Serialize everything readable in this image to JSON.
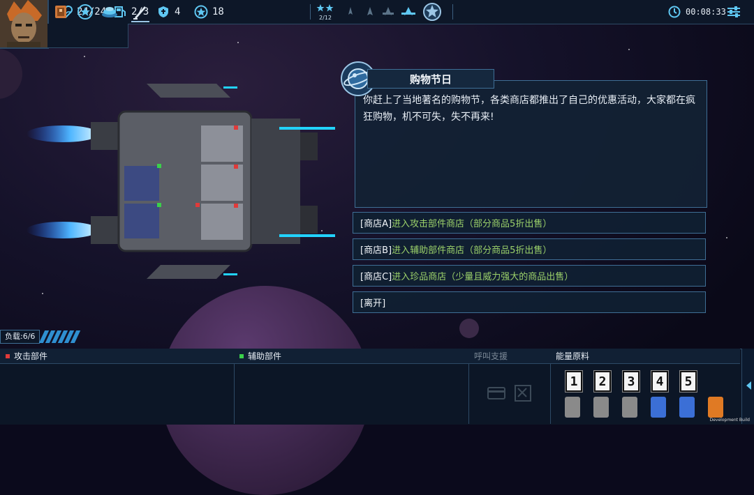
{
  "topbar": {
    "hull": "24/24",
    "fuel": "2/3",
    "shield": "4",
    "stars": "18",
    "sector_progress": "2/12",
    "timer": "00:08:33",
    "icons": [
      "heart-icon",
      "fuel-icon",
      "shield-icon",
      "star-coin-icon",
      "clock-icon",
      "settings-icon"
    ]
  },
  "event": {
    "title": "购物节日",
    "description": "你赶上了当地著名的购物节，各类商店都推出了自己的优惠活动，大家都在疯狂购物，机不可失，失不再来!",
    "options": [
      {
        "tag": "[商店A]",
        "text": "进入攻击部件商店（部分商品5折出售）"
      },
      {
        "tag": "[商店B]",
        "text": "进入辅助部件商店（部分商品5折出售）"
      },
      {
        "tag": "[商店C]",
        "text": "进入珍品商店（少量且威力强大的商品出售）"
      },
      {
        "tag": "[离开]",
        "text": ""
      }
    ]
  },
  "load": {
    "label": "负载:6/6"
  },
  "bottom": {
    "attack_parts": "攻击部件",
    "support_parts": "辅助部件",
    "call_support": "呼叫支援",
    "energy": "能量原料",
    "energy_slots": [
      "1",
      "2",
      "3",
      "4",
      "5"
    ],
    "card_colors": [
      "#8a8a8a",
      "#8a8a8a",
      "#8a8a8a",
      "#3b6fd6",
      "#3b6fd6",
      "#e07a24"
    ],
    "attack_color": "#e03a3a",
    "support_color": "#3ad04a"
  },
  "footer": {
    "build": "Development Build"
  }
}
